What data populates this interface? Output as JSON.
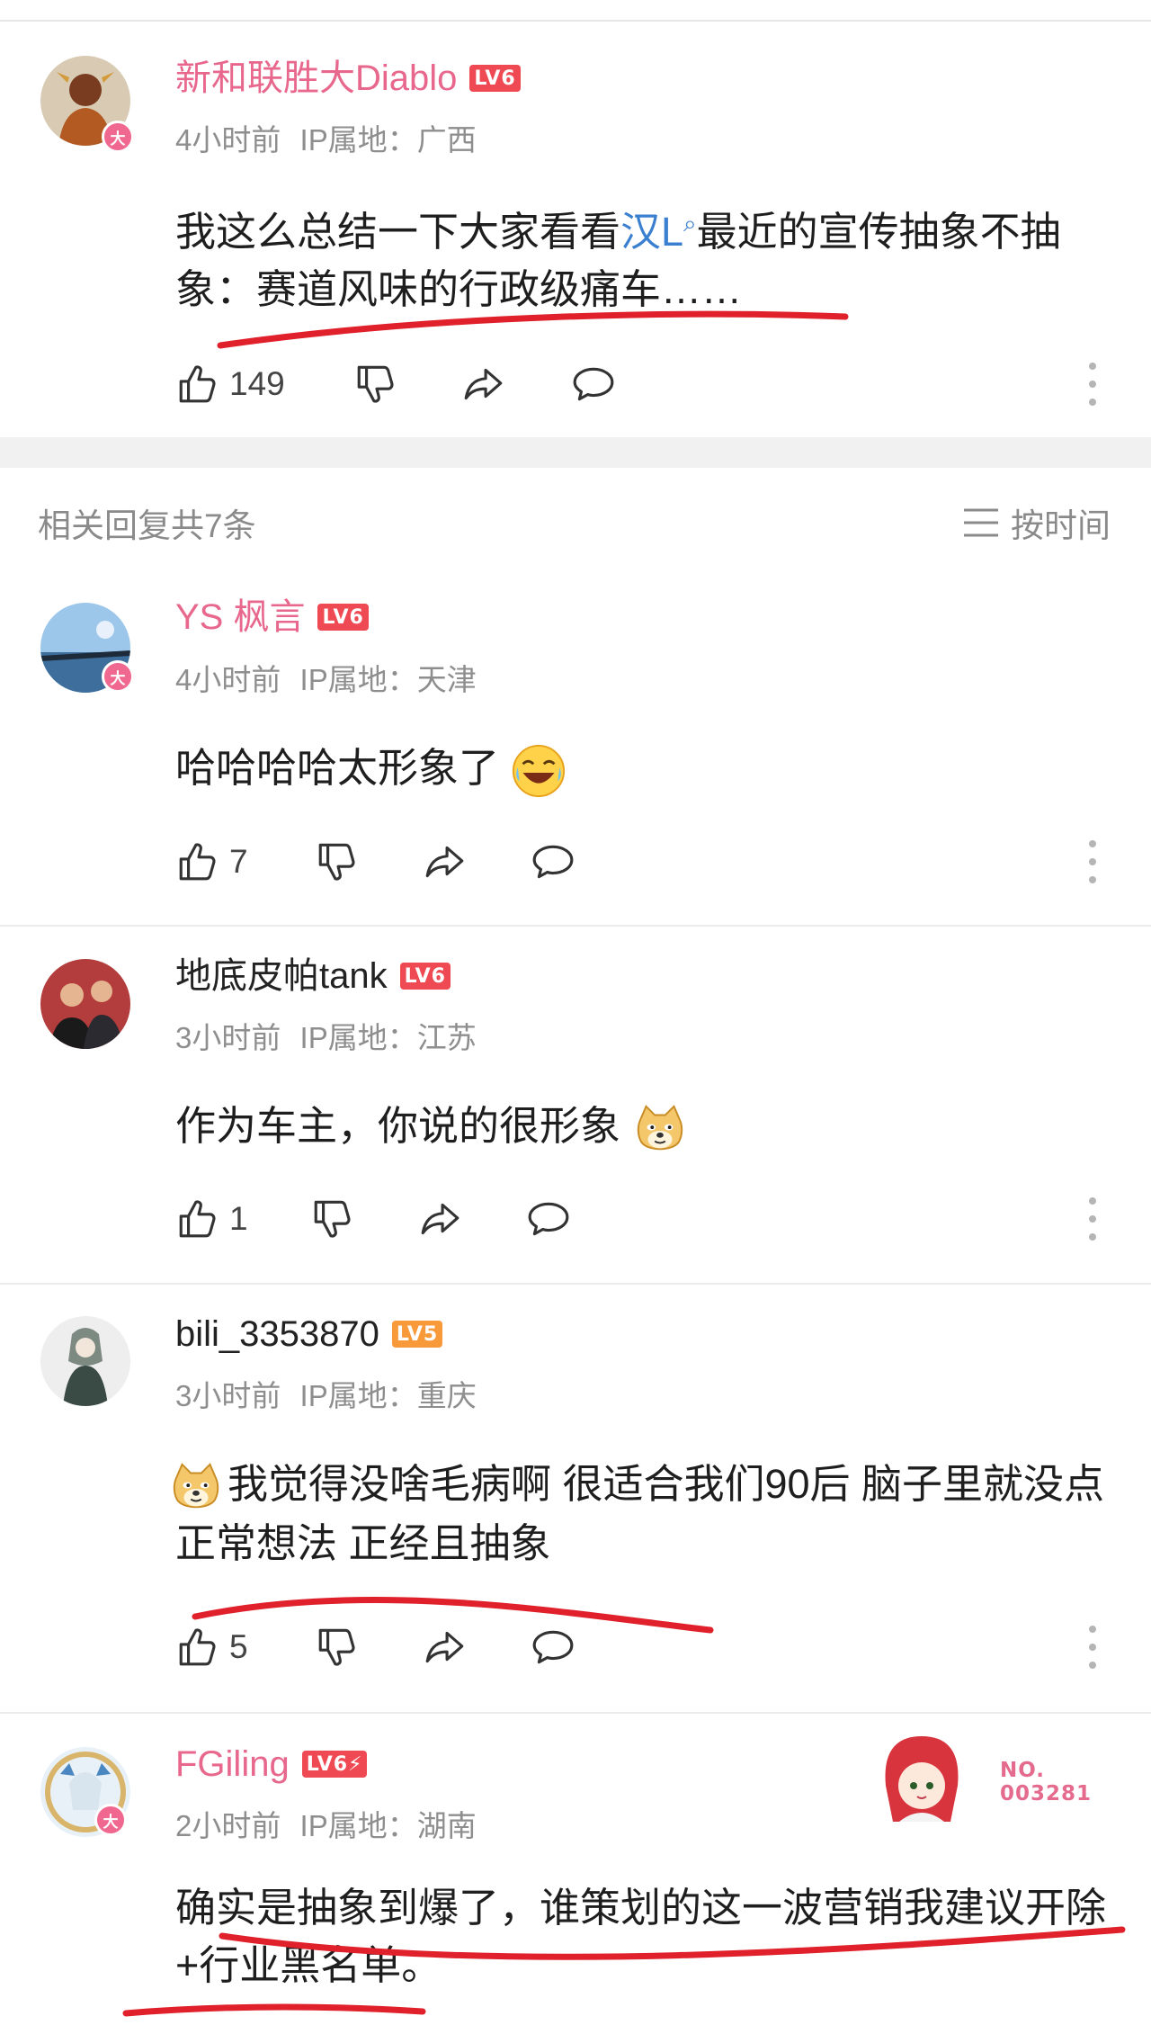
{
  "main_comment": {
    "username": "新和联胜大Diablo",
    "level": "LV6",
    "time": "4小时前",
    "ip_label": "IP属地：",
    "ip_location": "广西",
    "text_before_link": "我这么总结一下大家看看",
    "link_text": "汉L",
    "text_after_link": "最近的宣传抽象不抽象：赛道风味的行政级痛车……",
    "likes": "149"
  },
  "replies_header": {
    "count_label": "相关回复共7条",
    "sort_label": "按时间"
  },
  "replies": [
    {
      "username": "YS 枫言",
      "level": "LV6",
      "time": "4小时前",
      "ip_label": "IP属地：",
      "ip_location": "天津",
      "text": "哈哈哈哈太形象了",
      "likes": "7"
    },
    {
      "username": "地底皮帕tank",
      "level": "LV6",
      "time": "3小时前",
      "ip_label": "IP属地：",
      "ip_location": "江苏",
      "text": "作为车主，你说的很形象",
      "likes": "1"
    },
    {
      "username": "bili_3353870",
      "level": "LV5",
      "time": "3小时前",
      "ip_label": "IP属地：",
      "ip_location": "重庆",
      "text": "我觉得没啥毛病啊 很适合我们90后 脑子里就没点正常想法 正经且抽象",
      "likes": "5"
    },
    {
      "username": "FGiling",
      "level": "LV6⚡",
      "time": "2小时前",
      "ip_label": "IP属地：",
      "ip_location": "湖南",
      "pendant_label": "NO.\n003281",
      "text": "确实是抽象到爆了，谁策划的这一波营销我建议开除+行业黑名单。"
    }
  ],
  "icons": {
    "like": "thumbs-up-icon",
    "dislike": "thumbs-down-icon",
    "share": "share-arrow-icon",
    "reply": "chat-bubble-icon",
    "more": "more-vertical-icon",
    "sort": "sort-lines-icon"
  },
  "colors": {
    "username_vip": "#e8678c",
    "level_badge": "#ef4a53",
    "level_badge_lv5": "#f99a3a",
    "link": "#3a7fd0",
    "meta_gray": "#8e8e8e",
    "red_underline": "#e0202a"
  }
}
